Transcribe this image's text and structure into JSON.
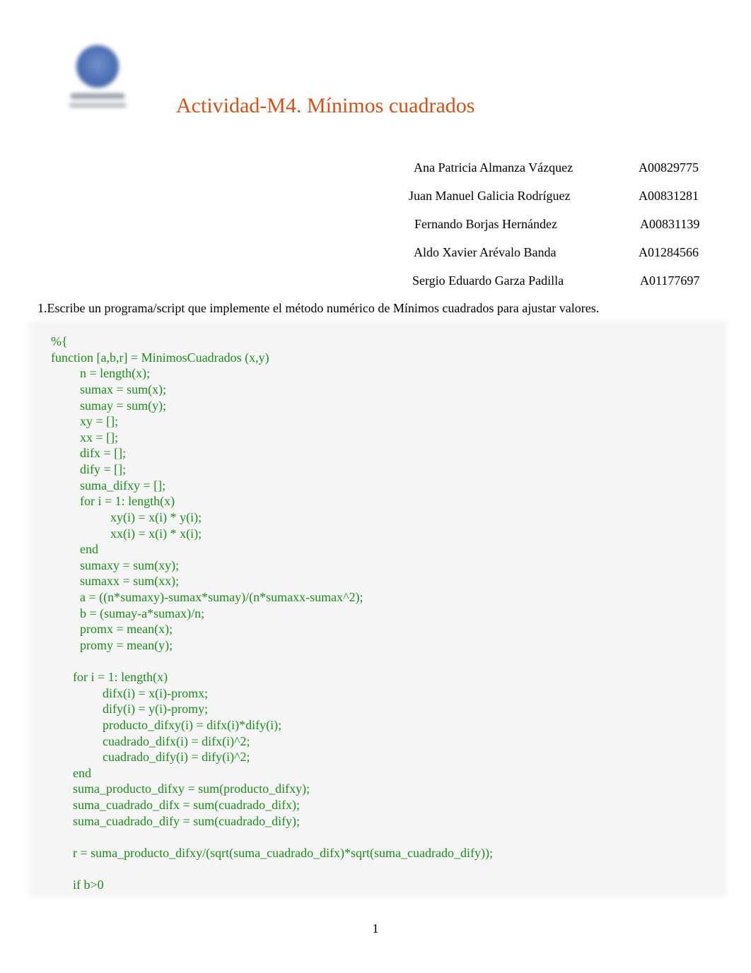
{
  "document": {
    "title": "Actividad-M4. Mínimos cuadrados",
    "logo": "university-seal-logo",
    "authors": [
      {
        "name": "Ana Patricia Almanza Vázquez",
        "id": "A00829775"
      },
      {
        "name": "Juan Manuel Galicia Rodríguez",
        "id": "A00831281"
      },
      {
        "name": "Fernando Borjas Hernández",
        "id": "A00831139"
      },
      {
        "name": "Aldo Xavier Arévalo Banda",
        "id": "A01284566"
      },
      {
        "name": "Sergio Eduardo Garza Padilla",
        "id": "A01177697"
      }
    ],
    "question": "1.Escribe un programa/script que implemente el método numérico de Mínimos cuadrados para ajustar valores.",
    "code_color": "#1e8a1e",
    "title_color": "#d1531a",
    "code_lines": [
      "%{",
      "function [a,b,r] = MinimosCuadrados (x,y)",
      "n = length(x);",
      "sumax = sum(x);",
      "sumay = sum(y);",
      "xy = [];",
      "xx = [];",
      "difx = [];",
      "dify = [];",
      "suma_difxy = [];",
      "for i = 1: length(x)",
      "xy(i) = x(i) * y(i);",
      "xx(i) = x(i) * x(i);",
      "end",
      "sumaxy = sum(xy);",
      "sumaxx = sum(xx);",
      "a = ((n*sumaxy)-sumax*sumay)/(n*sumaxx-sumax^2);",
      "b = (sumay-a*sumax)/n;",
      "promx = mean(x);",
      "promy = mean(y);",
      "for i = 1: length(x)",
      "difx(i) = x(i)-promx;",
      "dify(i) = y(i)-promy;",
      "producto_difxy(i) = difx(i)*dify(i);",
      "cuadrado_difx(i) = difx(i)^2;",
      "cuadrado_dify(i) = dify(i)^2;",
      "end",
      "suma_producto_difxy = sum(producto_difxy);",
      "suma_cuadrado_difx = sum(cuadrado_difx);",
      "suma_cuadrado_dify = sum(cuadrado_dify);",
      "r = suma_producto_difxy/(sqrt(suma_cuadrado_difx)*sqrt(suma_cuadrado_dify));",
      "if b>0"
    ],
    "page_number": "1"
  }
}
